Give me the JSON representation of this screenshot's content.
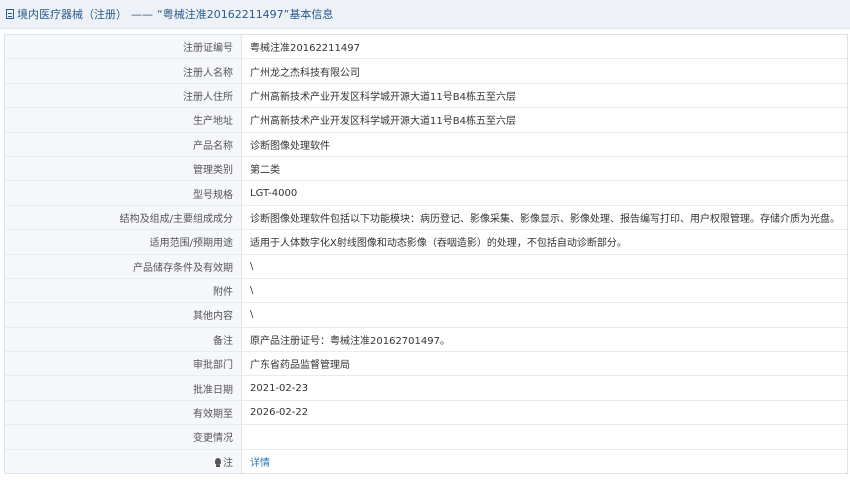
{
  "header": {
    "category": "境内医疗器械（注册）",
    "separator": "——",
    "title": "“粤械注准20162211497”基本信息",
    "icon": "document-icon"
  },
  "rows": [
    {
      "label": "注册证编号",
      "value": "粤械注准20162211497"
    },
    {
      "label": "注册人名称",
      "value": "广州龙之杰科技有限公司"
    },
    {
      "label": "注册人住所",
      "value": "广州高新技术产业开发区科学城开源大道11号B4栋五至六层"
    },
    {
      "label": "生产地址",
      "value": "广州高新技术产业开发区科学城开源大道11号B4栋五至六层"
    },
    {
      "label": "产品名称",
      "value": "诊断图像处理软件"
    },
    {
      "label": "管理类别",
      "value": "第二类"
    },
    {
      "label": "型号规格",
      "value": "LGT-4000"
    },
    {
      "label": "结构及组成/主要组成成分",
      "value": "诊断图像处理软件包括以下功能模块：病历登记、影像采集、影像显示、影像处理、报告编写打印、用户权限管理。存储介质为光盘。"
    },
    {
      "label": "适用范围/预期用途",
      "value": "适用于人体数字化X射线图像和动态影像（吞咽造影）的处理，不包括自动诊断部分。"
    },
    {
      "label": "产品储存条件及有效期",
      "value": "\\"
    },
    {
      "label": "附件",
      "value": "\\"
    },
    {
      "label": "其他内容",
      "value": "\\"
    },
    {
      "label": "备注",
      "value": "原产品注册证号：粤械注准20162701497。"
    },
    {
      "label": "审批部门",
      "value": "广东省药品监督管理局"
    },
    {
      "label": "批准日期",
      "value": "2021-02-23"
    },
    {
      "label": "有效期至",
      "value": "2026-02-22"
    },
    {
      "label": "变更情况",
      "value": ""
    }
  ],
  "note_row": {
    "label": "注",
    "icon": "lightbulb-icon",
    "link_text": "详情"
  },
  "colors": {
    "header_bg": "#eef2f7",
    "header_text": "#2a5a8c",
    "label_bg": "#f5f7fa",
    "link": "#2a7ab8"
  }
}
